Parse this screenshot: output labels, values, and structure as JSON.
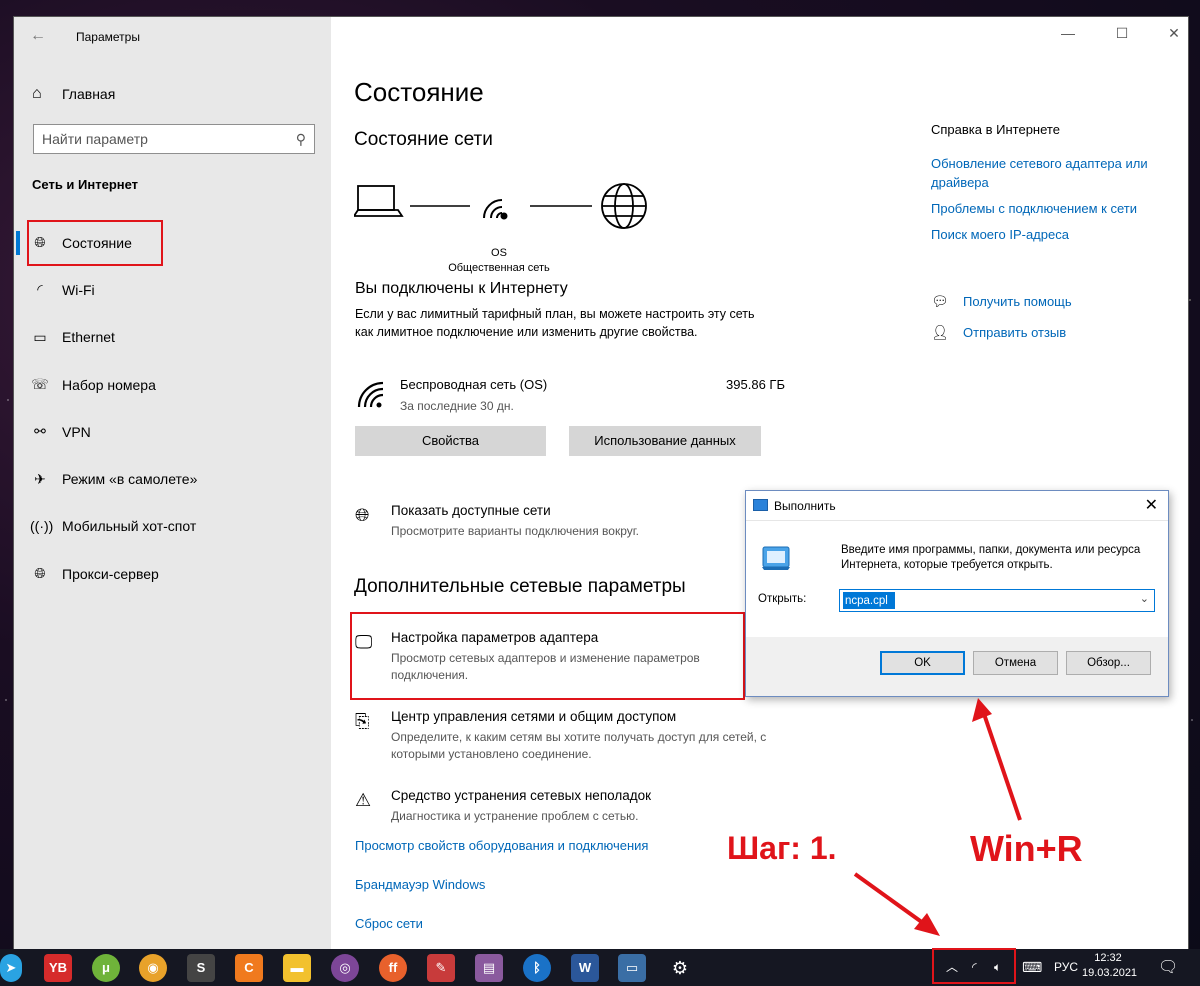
{
  "window": {
    "title": "Параметры",
    "back_label": "←",
    "controls": {
      "minimize": "—",
      "maximize": "☐",
      "close": "✕"
    }
  },
  "sidebar": {
    "home_label": "Главная",
    "search_placeholder": "Найти параметр",
    "section_title": "Сеть и Интернет",
    "items": [
      {
        "label": "Состояние",
        "icon": "globe-icon",
        "active": true
      },
      {
        "label": "Wi-Fi",
        "icon": "wifi-icon"
      },
      {
        "label": "Ethernet",
        "icon": "ethernet-icon"
      },
      {
        "label": "Набор номера",
        "icon": "dialup-icon"
      },
      {
        "label": "VPN",
        "icon": "vpn-icon"
      },
      {
        "label": "Режим «в самолете»",
        "icon": "airplane-icon"
      },
      {
        "label": "Мобильный хот-спот",
        "icon": "hotspot-icon"
      },
      {
        "label": "Прокси-сервер",
        "icon": "globe-icon"
      }
    ]
  },
  "main": {
    "page_title": "Состояние",
    "network_status_title": "Состояние сети",
    "diagram": {
      "network_name": "OS",
      "network_type": "Общественная сеть"
    },
    "connected_title": "Вы подключены к Интернету",
    "connected_desc": "Если у вас лимитный тарифный план, вы можете настроить эту сеть как лимитное подключение или изменить другие свойства.",
    "connection": {
      "name": "Беспроводная сеть (OS)",
      "period": "За последние 30 дн.",
      "usage": "395.86 ГБ"
    },
    "buttons": {
      "properties": "Свойства",
      "data_usage": "Использование данных"
    },
    "show_networks": {
      "title": "Показать доступные сети",
      "desc": "Просмотрите варианты подключения вокруг."
    },
    "advanced_title": "Дополнительные сетевые параметры",
    "adapter": {
      "title": "Настройка параметров адаптера",
      "desc": "Просмотр сетевых адаптеров и изменение параметров подключения."
    },
    "sharing_center": {
      "title": "Центр управления сетями и общим доступом",
      "desc": "Определите, к каким сетям вы хотите получать доступ для сетей, с которыми установлено соединение."
    },
    "troubleshooter": {
      "title": "Средство устранения сетевых неполадок",
      "desc": "Диагностика и устранение проблем с сетью."
    },
    "links": [
      "Просмотр свойств оборудования и подключения",
      "Брандмауэр Windows",
      "Сброс сети"
    ]
  },
  "right_panel": {
    "help_title": "Справка в Интернете",
    "links": [
      "Обновление сетевого адаптера или драйвера",
      "Проблемы с подключением к сети",
      "Поиск моего IP-адреса"
    ],
    "get_help": "Получить помощь",
    "feedback": "Отправить отзыв"
  },
  "run_dialog": {
    "title": "Выполнить",
    "close": "✕",
    "description": "Введите имя программы, папки, документа или ресурса Интернета, которые требуется открыть.",
    "open_label": "Открыть:",
    "open_value": "ncpa.cpl",
    "ok": "OK",
    "cancel": "Отмена",
    "browse": "Обзор..."
  },
  "annotations": {
    "step": "Шаг: 1.",
    "hotkey": "Win+R"
  },
  "taskbar": {
    "lang": "РУС",
    "time": "12:32",
    "date": "19.03.2021",
    "apps": [
      "telegram",
      "yandex-browser",
      "utorrent",
      "chrome",
      "sublime",
      "ccleaner",
      "explorer",
      "tor",
      "firefox",
      "paint",
      "winrar",
      "bluetooth",
      "word",
      "settings-app",
      "gear"
    ]
  },
  "colors": {
    "accent": "#0078d4",
    "link": "#0067b8",
    "highlight": "#e0141a",
    "sidebar_bg": "#e8e8e8"
  }
}
